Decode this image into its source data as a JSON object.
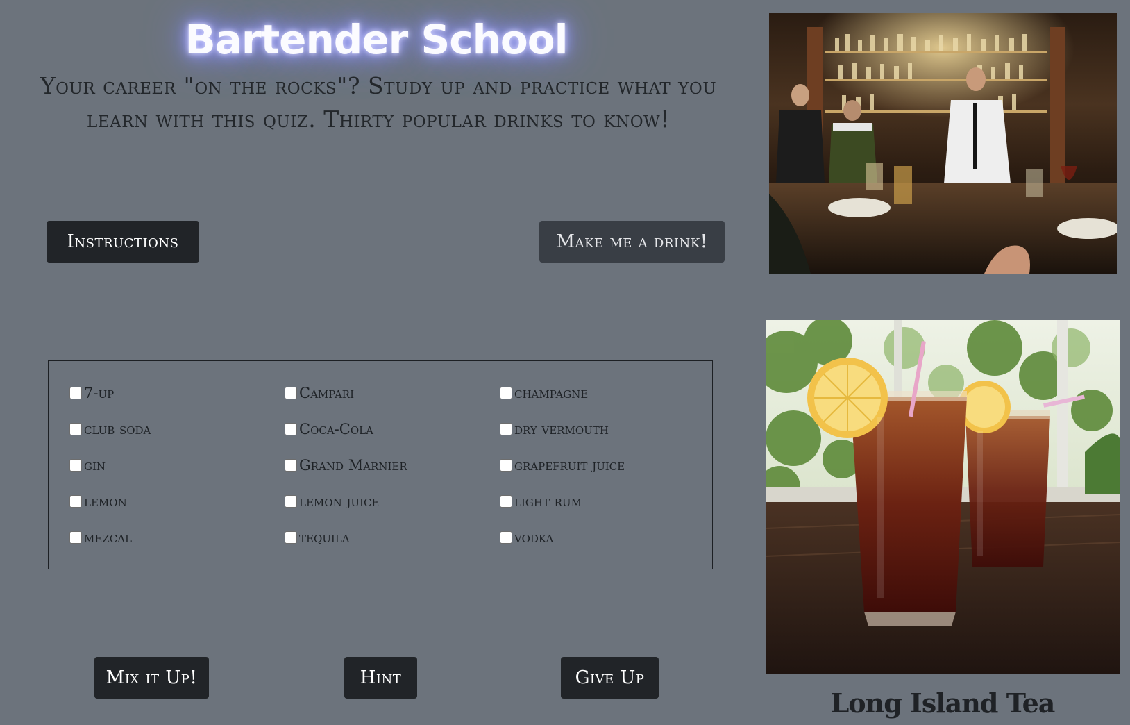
{
  "header": {
    "title": "Bartender School",
    "subtitle": "Your career \"on the rocks\"? Study up and practice what you learn with this quiz. Thirty popular drinks to know!"
  },
  "top_buttons": {
    "instructions": "Instructions",
    "make_drink": "Make me a drink!"
  },
  "ingredients": [
    "7-up",
    "Campari",
    "champagne",
    "club soda",
    "Coca-Cola",
    "dry vermouth",
    "gin",
    "Grand Marnier",
    "grapefruit juice",
    "lemon",
    "lemon juice",
    "light rum",
    "mezcal",
    "tequila",
    "vodka"
  ],
  "bottom_buttons": {
    "mix": "Mix it Up!",
    "hint": "Hint",
    "give_up": "Give Up"
  },
  "drink": {
    "name": "Long Island Tea"
  },
  "colors": {
    "background": "#6c737c",
    "button": "#212428",
    "button_muted": "#393e45",
    "title_glow": "#8a90ff"
  }
}
